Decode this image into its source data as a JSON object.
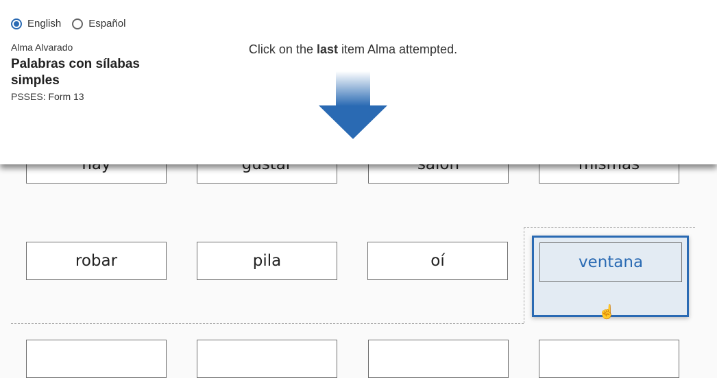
{
  "language": {
    "options": [
      "English",
      "Español"
    ],
    "selected": "English"
  },
  "student": "Alma Alvarado",
  "assessment_title": "Palabras con sílabas simples",
  "form": "PSSES: Form 13",
  "instruction": {
    "before": "Click on the ",
    "bold": "last",
    "after": " item Alma attempted."
  },
  "icons": {
    "arrow": "down-arrow-icon",
    "cursor": "hand-pointer-icon"
  },
  "colors": {
    "accent": "#2a6ab3",
    "highlight_bg": "#e3ebf3"
  },
  "words": {
    "row1": [
      "hay",
      "gustar",
      "salón",
      "mismas"
    ],
    "row2": [
      "robar",
      "pila",
      "oí",
      "ventana"
    ],
    "row3": [
      "",
      "",
      "",
      ""
    ]
  },
  "selected_word": "ventana"
}
